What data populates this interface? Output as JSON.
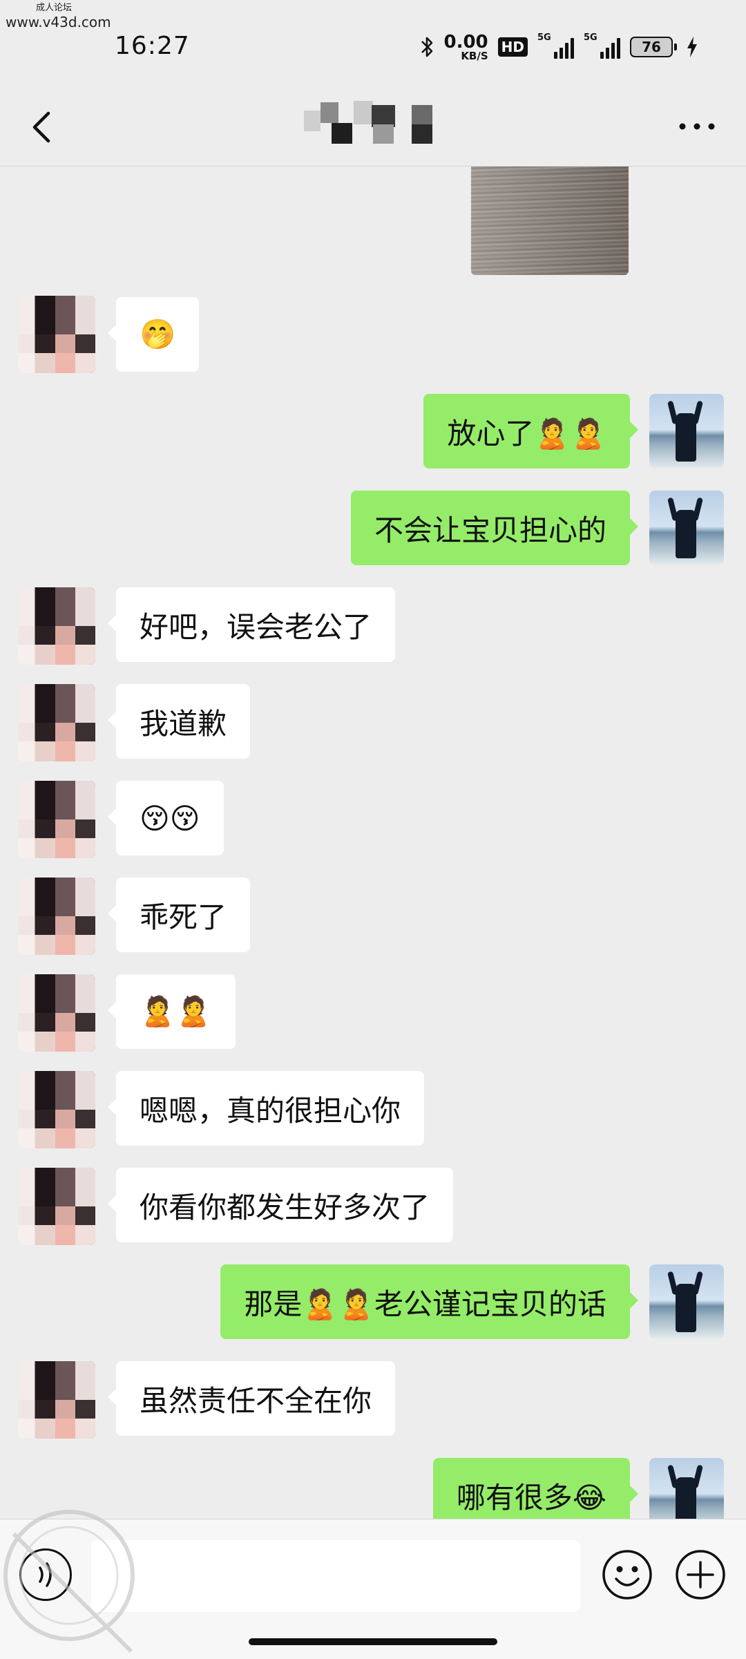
{
  "watermark_top": {
    "line1": "成人论坛",
    "line2": "www.v43d.com"
  },
  "status_bar": {
    "time": "16:27",
    "net_speed_value": "0.00",
    "net_speed_unit": "KB/S",
    "hd_label": "HD",
    "signal1_label": "5G",
    "signal2_label": "5G",
    "battery": "76",
    "icons": [
      "bluetooth-icon",
      "hd-voice-icon",
      "signal-icon",
      "signal-icon",
      "battery-icon",
      "charging-icon"
    ]
  },
  "header": {
    "back_icon": "chevron-left-icon",
    "more_icon": "more-horizontal-icon",
    "title": ""
  },
  "messages": [
    {
      "side": "in",
      "text": "🤭"
    },
    {
      "side": "out",
      "text": "放心了🙎🙎"
    },
    {
      "side": "out",
      "text": "不会让宝贝担心的"
    },
    {
      "side": "in",
      "text": "好吧，误会老公了"
    },
    {
      "side": "in",
      "text": "我道歉"
    },
    {
      "side": "in",
      "text": "😚😚"
    },
    {
      "side": "in",
      "text": "乖死了"
    },
    {
      "side": "in",
      "text": "🙎🙎"
    },
    {
      "side": "in",
      "text": "嗯嗯，真的很担心你"
    },
    {
      "side": "in",
      "text": "你看你都发生好多次了"
    },
    {
      "side": "out",
      "text": "那是🙎🙎老公谨记宝贝的话"
    },
    {
      "side": "in",
      "text": "虽然责任不全在你"
    },
    {
      "side": "out",
      "text": "哪有很多😂"
    }
  ],
  "input_bar": {
    "voice_icon": "voice-icon",
    "emoji_icon": "emoji-icon",
    "plus_icon": "plus-circle-icon",
    "field_value": ""
  },
  "colors": {
    "background": "#EDEDED",
    "outgoing_bubble": "#95EC69",
    "incoming_bubble": "#FFFFFF"
  }
}
